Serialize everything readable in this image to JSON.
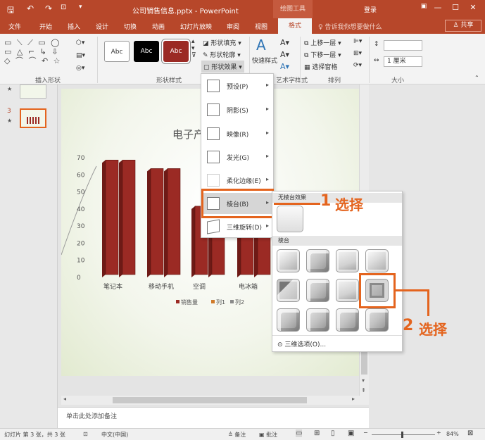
{
  "window": {
    "title": "公司销售信息.pptx - PowerPoint",
    "context_tools": "绘图工具",
    "login": "登录",
    "minimize": "—",
    "restore": "☐",
    "close": "✕"
  },
  "quick_access": {
    "save": "🖫",
    "undo": "↶",
    "redo": "↷",
    "customize": "▾"
  },
  "tabs": [
    "文件",
    "开始",
    "插入",
    "设计",
    "切换",
    "动画",
    "幻灯片放映",
    "审阅",
    "视图"
  ],
  "active_tab": "格式",
  "tell_me": "♀ 告诉我你想要做什么",
  "share": "♙ 共享",
  "ribbon": {
    "groups": [
      "插入形状",
      "形状样式",
      "艺术字样式",
      "排列",
      "大小"
    ],
    "style_samples": [
      "Abc",
      "Abc",
      "Abc"
    ],
    "shape_fill": "形状填充 ▾",
    "shape_outline": "形状轮廓 ▾",
    "shape_effects": "形状效果 ▾",
    "quick_styles": "快速样式",
    "bring_forward": "上移一层 ▾",
    "send_backward": "下移一层 ▾",
    "selection_pane": "选择窗格",
    "width_value": "1 厘米",
    "height_value": ""
  },
  "colors": {
    "accent": "#b7472a",
    "highlight": "#e4641e",
    "bar": "#9b2a24"
  },
  "thumbnails": [
    {
      "num": "",
      "star": "★"
    },
    {
      "num": "3",
      "star": "★"
    }
  ],
  "slide": {
    "title_fragment": "电子产"
  },
  "chart_data": {
    "type": "bar",
    "title": "电子产",
    "categories": [
      "笔记本",
      "移动手机",
      "空调",
      "电冰箱"
    ],
    "yticks": [
      "70",
      "60",
      "50",
      "40",
      "30",
      "20",
      "10",
      "0"
    ],
    "ylim": [
      0,
      70
    ],
    "series": [
      {
        "name": "销售量",
        "values": [
          67,
          62,
          40,
          60
        ]
      },
      {
        "name": "列1",
        "values": [
          0,
          0,
          0,
          0
        ]
      },
      {
        "name": "列2",
        "values": [
          0,
          0,
          0,
          0
        ]
      }
    ],
    "legend_items": [
      "销售量",
      "列1",
      "列2"
    ],
    "legend_colors": [
      "#9b2a24",
      "#d07a2a",
      "#8a8a8a"
    ]
  },
  "effects_menu": [
    {
      "label": "预设(P)",
      "arrow": "▸"
    },
    {
      "label": "阴影(S)",
      "arrow": "▸"
    },
    {
      "label": "映像(R)",
      "arrow": "▸"
    },
    {
      "label": "发光(G)",
      "arrow": "▸"
    },
    {
      "label": "柔化边缘(E)",
      "arrow": "▸"
    },
    {
      "label": "棱台(B)",
      "arrow": "▸"
    },
    {
      "label": "三维旋转(D)",
      "arrow": "▸"
    }
  ],
  "bevel_menu": {
    "no_bevel_header": "无棱台效果",
    "bevel_header": "棱台",
    "three_d_options": "三维选项(O)..."
  },
  "callouts": [
    {
      "num": "1",
      "text": "选择"
    },
    {
      "num": "2",
      "text": "选择"
    }
  ],
  "notes_placeholder": "单击此处添加备注",
  "status": {
    "slide_info": "幻灯片 第 3 张，共 3 张",
    "language": "中文(中国)",
    "notes": "≜ 备注",
    "comments": "▣ 批注",
    "zoom": "84%"
  }
}
